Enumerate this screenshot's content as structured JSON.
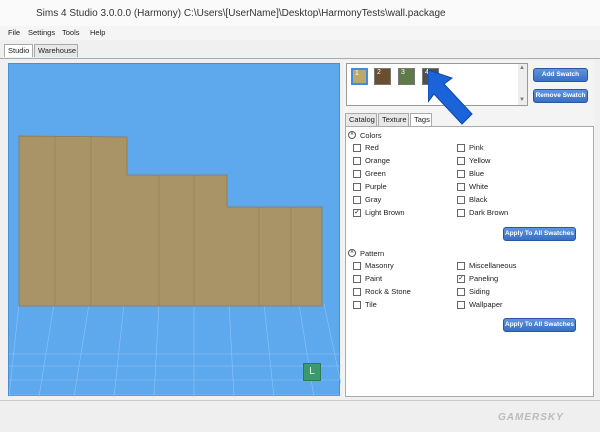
{
  "window": {
    "title": "Sims 4 Studio 3.0.0.0 (Harmony)  C:\\Users\\[UserName]\\Desktop\\HarmonyTests\\wall.package"
  },
  "menu": [
    "File",
    "Settings",
    "Tools",
    "Help"
  ],
  "main_tabs": [
    "Studio",
    "Warehouse"
  ],
  "swatches": [
    {
      "label": "1",
      "color": "#bfa76a"
    },
    {
      "label": "2",
      "color": "#6b4e2e"
    },
    {
      "label": "3",
      "color": "#5e7a48"
    },
    {
      "label": "4",
      "color": "#4f4f52"
    }
  ],
  "buttons": {
    "add_swatch": "Add Swatch",
    "remove_swatch": "Remove Swatch",
    "apply_all_1": "Apply To All Swatches",
    "apply_all_2": "Apply To All Swatches"
  },
  "inner_tabs": [
    "Catalog",
    "Texture",
    "Tags"
  ],
  "colors_section": {
    "title": "Colors",
    "left": [
      {
        "label": "Red",
        "checked": false
      },
      {
        "label": "Orange",
        "checked": false
      },
      {
        "label": "Green",
        "checked": false
      },
      {
        "label": "Purple",
        "checked": false
      },
      {
        "label": "Gray",
        "checked": false
      },
      {
        "label": "Light Brown",
        "checked": true
      }
    ],
    "right": [
      {
        "label": "Pink",
        "checked": false
      },
      {
        "label": "Yellow",
        "checked": false
      },
      {
        "label": "Blue",
        "checked": false
      },
      {
        "label": "White",
        "checked": false
      },
      {
        "label": "Black",
        "checked": false
      },
      {
        "label": "Dark Brown",
        "checked": false
      }
    ]
  },
  "pattern_section": {
    "title": "Pattern",
    "left": [
      {
        "label": "Masonry",
        "checked": false
      },
      {
        "label": "Paint",
        "checked": false
      },
      {
        "label": "Rock & Stone",
        "checked": false
      },
      {
        "label": "Tile",
        "checked": false
      }
    ],
    "right": [
      {
        "label": "Miscellaneous",
        "checked": false
      },
      {
        "label": "Paneling",
        "checked": true
      },
      {
        "label": "Siding",
        "checked": false
      },
      {
        "label": "Wallpaper",
        "checked": false
      }
    ]
  },
  "viewport": {
    "badge": "L",
    "background": "#5ea8ee",
    "wall_color": "#a89466"
  },
  "watermark": "GAMERSKY"
}
